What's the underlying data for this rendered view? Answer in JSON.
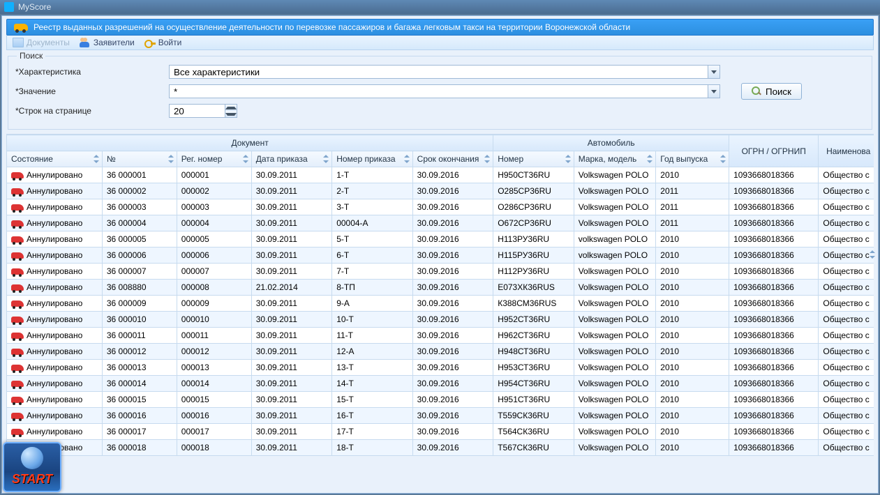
{
  "window": {
    "title": "MyScore"
  },
  "header": {
    "title": "Реестр выданных разрешений на осуществление деятельности по перевозке пассажиров и багажа легковым такси на территории Воронежской области"
  },
  "toolbar": {
    "documents": "Документы",
    "applicants": "Заявители",
    "login": "Войти"
  },
  "search": {
    "legend": "Поиск",
    "char_label": "*Характеристика",
    "char_value": "Все характеристики",
    "val_label": "*Значение",
    "val_value": "*",
    "rows_label": "*Строк на странице",
    "rows_value": "20",
    "button": "Поиск"
  },
  "grid": {
    "groups": {
      "doc": "Документ",
      "auto": "Автомобиль"
    },
    "cols": {
      "state": "Состояние",
      "num": "№",
      "reg": "Рег. номер",
      "order_date": "Дата приказа",
      "order_num": "Номер приказа",
      "expiry": "Срок окончания",
      "plate": "Номер",
      "make": "Марка, модель",
      "year": "Год выпуска",
      "ogrn": "ОГРН / ОГРНИП",
      "name": "Наименова"
    },
    "status_label": "Аннулировано",
    "name_partial": "Общество с",
    "rows": [
      {
        "n": "36 000001",
        "r": "000001",
        "d": "30.09.2011",
        "on": "1-Т",
        "e": "30.09.2016",
        "p": "Н950СТ36RU",
        "m": "Volkswagen POLO",
        "y": "2010",
        "o": "1093668018366"
      },
      {
        "n": "36 000002",
        "r": "000002",
        "d": "30.09.2011",
        "on": "2-Т",
        "e": "30.09.2016",
        "p": "О285СР36RU",
        "m": "Volkswagen POLO",
        "y": "2011",
        "o": "1093668018366"
      },
      {
        "n": "36 000003",
        "r": "000003",
        "d": "30.09.2011",
        "on": "3-Т",
        "e": "30.09.2016",
        "p": "О286СР36RU",
        "m": "Volkswagen POLO",
        "y": "2011",
        "o": "1093668018366"
      },
      {
        "n": "36 000004",
        "r": "000004",
        "d": "30.09.2011",
        "on": "00004-А",
        "e": "30.09.2016",
        "p": "О672СР36RU",
        "m": "Volkswagen POLO",
        "y": "2011",
        "o": "1093668018366"
      },
      {
        "n": "36 000005",
        "r": "000005",
        "d": "30.09.2011",
        "on": "5-Т",
        "e": "30.09.2016",
        "p": "Н113РУ36RU",
        "m": "volkswagen POLO",
        "y": "2010",
        "o": "1093668018366"
      },
      {
        "n": "36 000006",
        "r": "000006",
        "d": "30.09.2011",
        "on": "6-Т",
        "e": "30.09.2016",
        "p": "Н115РУ36RU",
        "m": "volkswagen POLO",
        "y": "2010",
        "o": "1093668018366"
      },
      {
        "n": "36 000007",
        "r": "000007",
        "d": "30.09.2011",
        "on": "7-Т",
        "e": "30.09.2016",
        "p": "Н112РУ36RU",
        "m": "Volkswagen POLO",
        "y": "2010",
        "o": "1093668018366"
      },
      {
        "n": "36 008880",
        "r": "000008",
        "d": "21.02.2014",
        "on": "8-ТП",
        "e": "30.09.2016",
        "p": "Е073ХК36RUS",
        "m": "Volkswagen POLO",
        "y": "2010",
        "o": "1093668018366"
      },
      {
        "n": "36 000009",
        "r": "000009",
        "d": "30.09.2011",
        "on": "9-А",
        "e": "30.09.2016",
        "p": "К388СМ36RUS",
        "m": "Volkswagen POLO",
        "y": "2010",
        "o": "1093668018366"
      },
      {
        "n": "36 000010",
        "r": "000010",
        "d": "30.09.2011",
        "on": "10-Т",
        "e": "30.09.2016",
        "p": "Н952СТ36RU",
        "m": "Volkswagen POLO",
        "y": "2010",
        "o": "1093668018366"
      },
      {
        "n": "36 000011",
        "r": "000011",
        "d": "30.09.2011",
        "on": "11-Т",
        "e": "30.09.2016",
        "p": "Н962СТ36RU",
        "m": "Volkswagen POLO",
        "y": "2010",
        "o": "1093668018366"
      },
      {
        "n": "36 000012",
        "r": "000012",
        "d": "30.09.2011",
        "on": "12-А",
        "e": "30.09.2016",
        "p": "Н948СТ36RU",
        "m": "Volkswagen POLO",
        "y": "2010",
        "o": "1093668018366"
      },
      {
        "n": "36 000013",
        "r": "000013",
        "d": "30.09.2011",
        "on": "13-Т",
        "e": "30.09.2016",
        "p": "Н953СТ36RU",
        "m": "Volkswagen POLO",
        "y": "2010",
        "o": "1093668018366"
      },
      {
        "n": "36 000014",
        "r": "000014",
        "d": "30.09.2011",
        "on": "14-Т",
        "e": "30.09.2016",
        "p": "Н954СТ36RU",
        "m": "Volkswagen POLO",
        "y": "2010",
        "o": "1093668018366"
      },
      {
        "n": "36 000015",
        "r": "000015",
        "d": "30.09.2011",
        "on": "15-Т",
        "e": "30.09.2016",
        "p": "Н951СТ36RU",
        "m": "Volkswagen POLO",
        "y": "2010",
        "o": "1093668018366"
      },
      {
        "n": "36 000016",
        "r": "000016",
        "d": "30.09.2011",
        "on": "16-Т",
        "e": "30.09.2016",
        "p": "Т559СК36RU",
        "m": "Volkswagen POLO",
        "y": "2010",
        "o": "1093668018366"
      },
      {
        "n": "36 000017",
        "r": "000017",
        "d": "30.09.2011",
        "on": "17-Т",
        "e": "30.09.2016",
        "p": "Т564СК36RU",
        "m": "Volkswagen POLO",
        "y": "2010",
        "o": "1093668018366"
      },
      {
        "n": "36 000018",
        "r": "000018",
        "d": "30.09.2011",
        "on": "18-Т",
        "e": "30.09.2016",
        "p": "Т567СК36RU",
        "m": "Volkswagen POLO",
        "y": "2010",
        "o": "1093668018366"
      }
    ]
  },
  "start_badge": "START"
}
